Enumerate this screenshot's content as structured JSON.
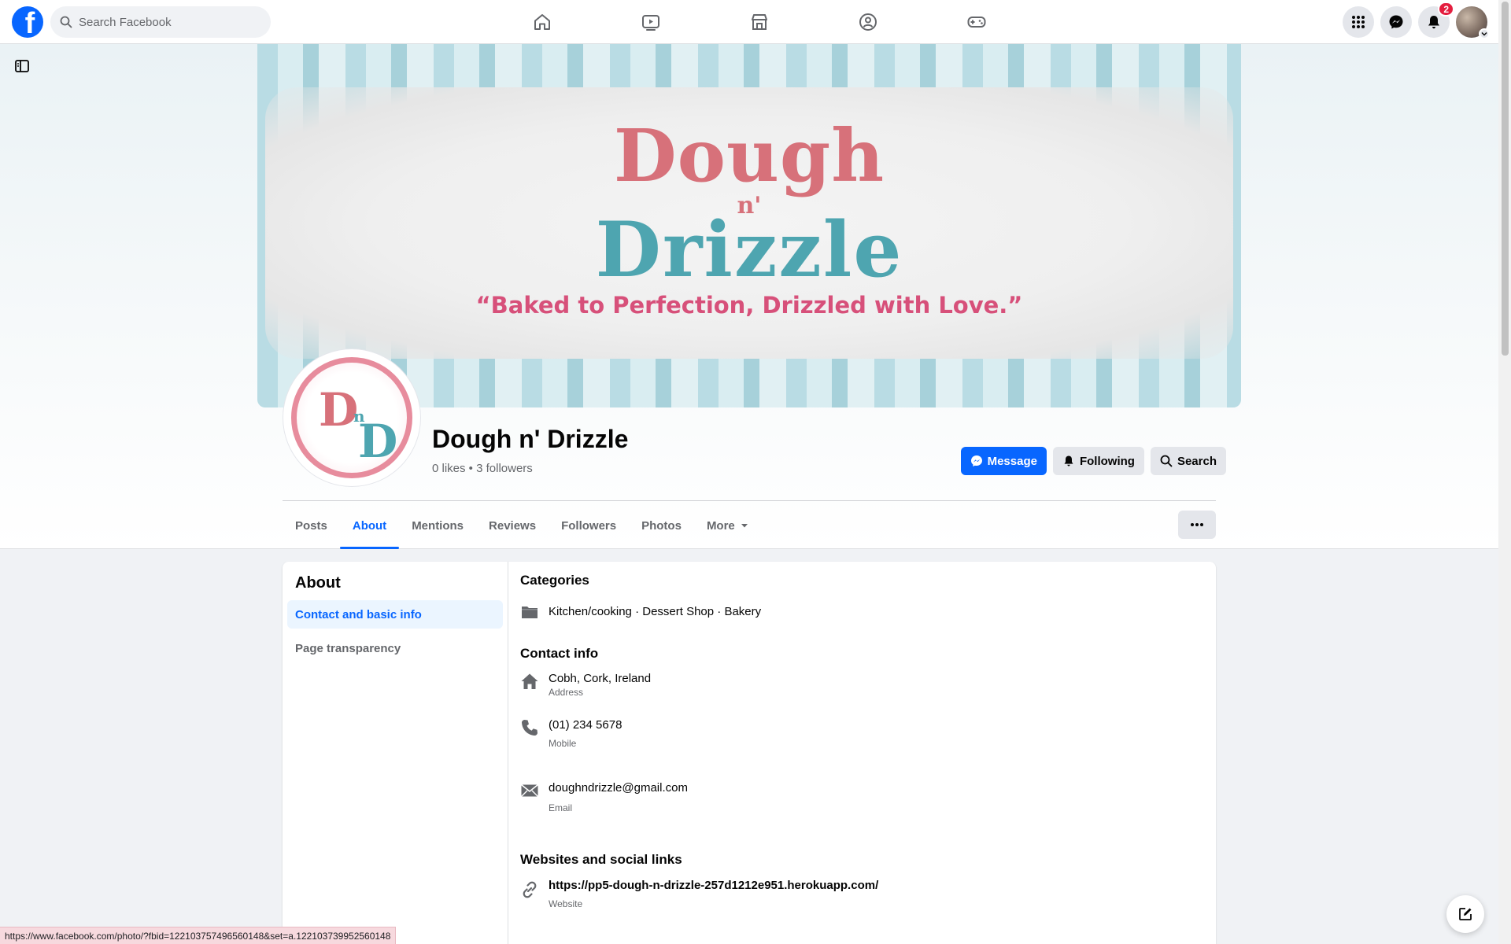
{
  "topbar": {
    "logo_letter": "f",
    "search_placeholder": "Search Facebook",
    "nav_icons": [
      "home-icon",
      "video-icon",
      "marketplace-icon",
      "groups-icon",
      "gaming-icon"
    ],
    "right_icons": [
      "menu-grid-icon",
      "messenger-icon",
      "bell-icon"
    ],
    "notification_count": "2"
  },
  "cover": {
    "title_line1": "Dough",
    "title_mid": "n'",
    "title_line2": "Drizzle",
    "tagline": "“Baked to Perfection, Drizzled with Love.”"
  },
  "profile_pic": {
    "letter1": "D",
    "letter_mid": "n",
    "letter2": "D"
  },
  "page": {
    "name": "Dough n' Drizzle",
    "stats": "0 likes • 3 followers"
  },
  "actions": {
    "message": "Message",
    "following": "Following",
    "search": "Search"
  },
  "tabs": [
    {
      "label": "Posts"
    },
    {
      "label": "About"
    },
    {
      "label": "Mentions"
    },
    {
      "label": "Reviews"
    },
    {
      "label": "Followers"
    },
    {
      "label": "Photos"
    },
    {
      "label": "More"
    }
  ],
  "active_tab": "About",
  "about": {
    "heading": "About",
    "nav": [
      {
        "label": "Contact and basic info"
      },
      {
        "label": "Page transparency"
      }
    ],
    "categories_title": "Categories",
    "categories": "Kitchen/cooking · Dessert Shop · Bakery",
    "contact_title": "Contact info",
    "address": {
      "value": "Cobh, Cork, Ireland",
      "label": "Address"
    },
    "phone": {
      "value": "(01) 234 5678",
      "label": "Mobile"
    },
    "email": {
      "value": "doughndrizzle@gmail.com",
      "label": "Email"
    },
    "websites_title": "Websites and social links",
    "website": {
      "value": "https://pp5-dough-n-drizzle-257d1212e951.herokuapp.com/",
      "label": "Website"
    }
  },
  "status_bar_url": "https://www.facebook.com/photo/?fbid=122103757496560148&set=a.122103739952560148",
  "colors": {
    "brand": "#0866ff",
    "cover_pink": "#d7717a",
    "cover_teal": "#4ea5b0",
    "badge_red": "#e41e3f"
  }
}
